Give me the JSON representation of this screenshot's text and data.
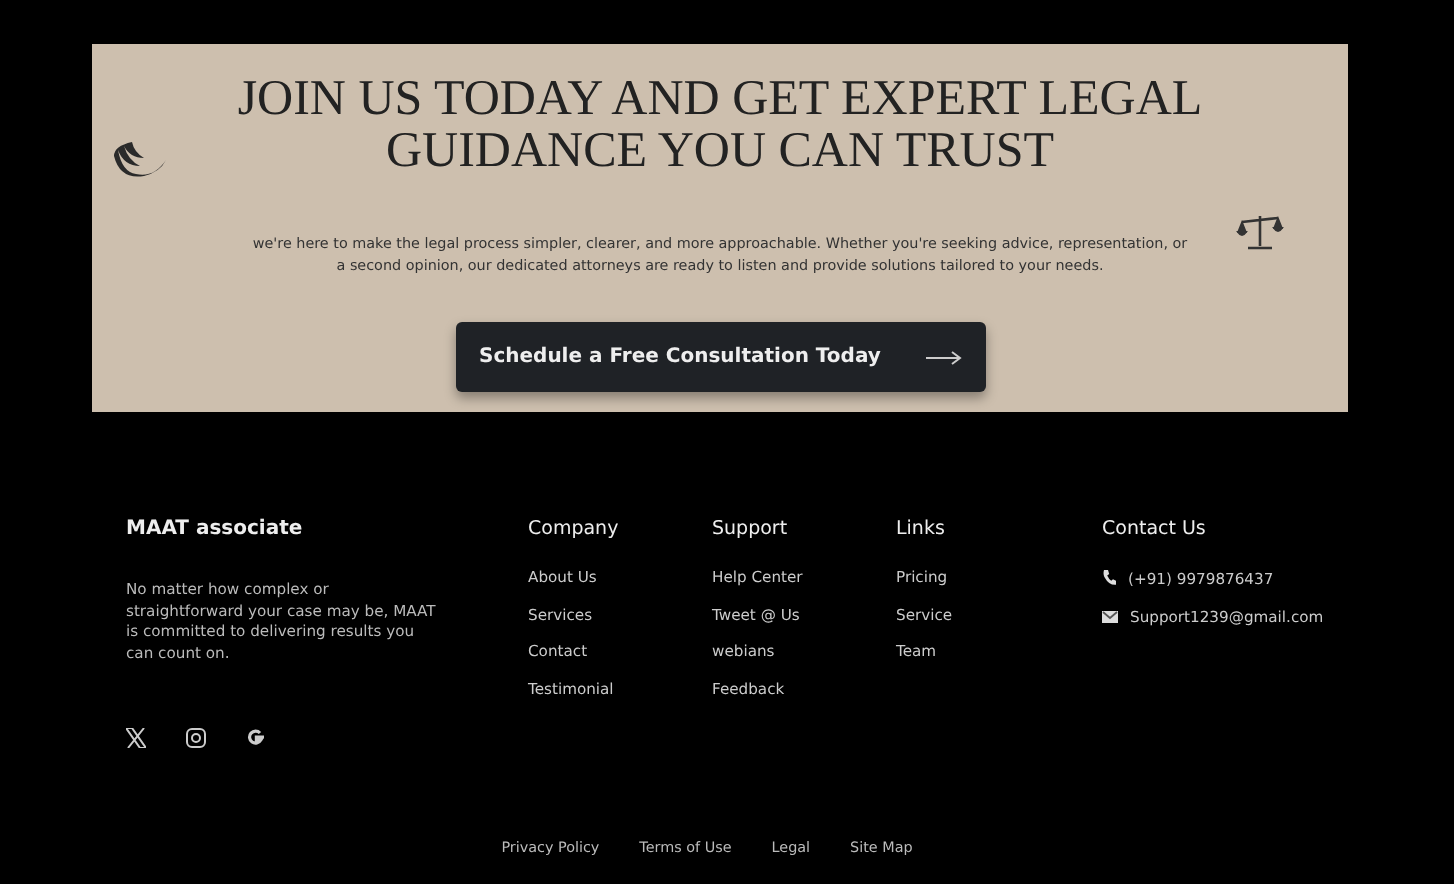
{
  "banner": {
    "heading": "JOIN US TODAY AND GET EXPERT LEGAL GUIDANCE YOU CAN TRUST",
    "text": "we're here to make the legal process simpler, clearer, and more approachable. Whether you're seeking advice, representation, or a second opinion, our dedicated attorneys are ready to listen and provide solutions tailored to your needs.",
    "button": "Schedule a Free Consultation Today"
  },
  "footer": {
    "brand": "MAAT associate",
    "about": "No matter how complex or straightforward your case may be, MAAT is committed to delivering results you can count on.",
    "columns": [
      {
        "title": "Company",
        "links": [
          "About Us",
          "Services",
          "Contact",
          "Testimonial"
        ]
      },
      {
        "title": "Support",
        "links": [
          "Help Center",
          "Tweet @ Us",
          "webians",
          "Feedback"
        ]
      },
      {
        "title": "Links",
        "links": [
          "Pricing",
          "Service",
          "Team"
        ]
      }
    ],
    "contact": {
      "title": "Contact Us",
      "items": [
        {
          "kind": "phone",
          "text": "(+91) 9979876437"
        },
        {
          "kind": "email",
          "text": "Support1239@gmail.com"
        }
      ]
    },
    "bottom_links": [
      "Privacy Policy",
      "Terms of Use",
      "Legal",
      "Site Map"
    ]
  }
}
